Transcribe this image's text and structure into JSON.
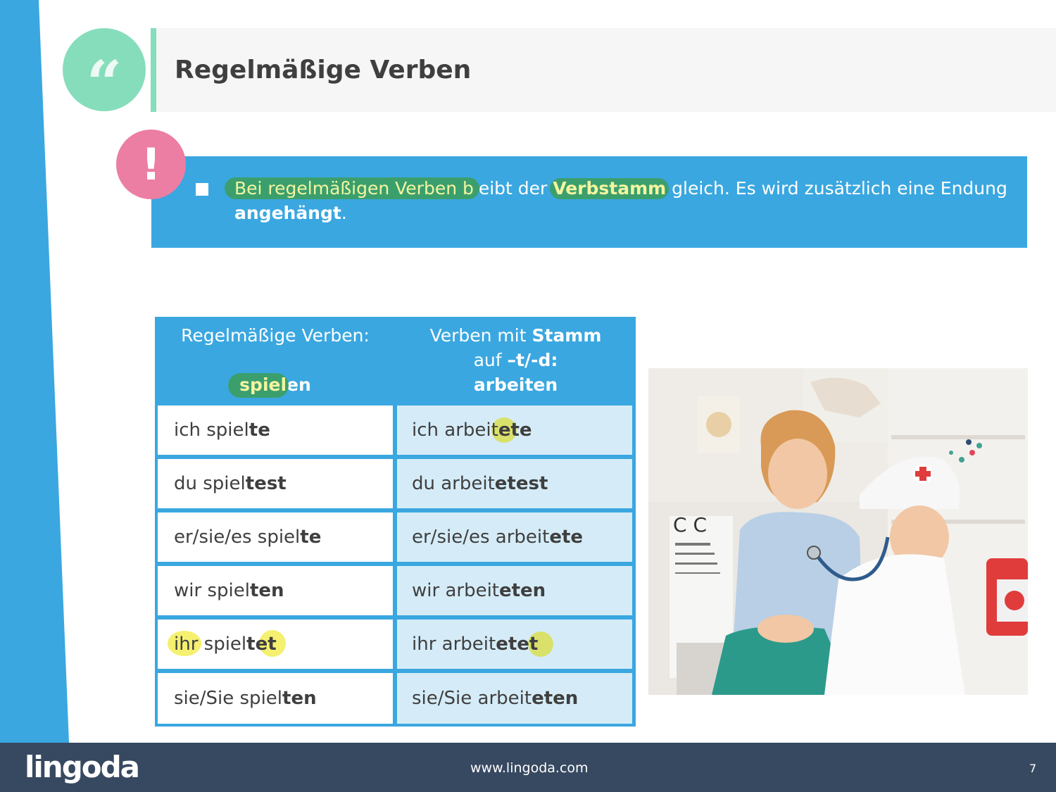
{
  "slide": {
    "title": "Regelmäßige Verben",
    "quote_glyph": "“",
    "alert_glyph": "!"
  },
  "info": {
    "part1": "Bei regelmäßigen Verben b",
    "part2": "leibt der ",
    "part3": "Verbstamm",
    "part4": " gleich. Es  wird zusätzlich eine Endung ",
    "part5": "angehängt",
    "part6": "."
  },
  "table": {
    "col1_header": "Regelmäßige Verben:",
    "col1_stem": "spiel",
    "col1_ending": "en",
    "col2_header_prefix": "Verben mit ",
    "col2_header_bold": "Stamm",
    "col2_header_line2_prefix": "auf ",
    "col2_header_line2_bold": "–t/-d:",
    "col2_header_verb": "arbeiten",
    "rows": [
      {
        "c1_stem": "ich spiel",
        "c1_end": "te",
        "c2_stem": "ich arbeit",
        "c2_end": "ete"
      },
      {
        "c1_stem": "du spiel",
        "c1_end": "test",
        "c2_stem": "du arbeit",
        "c2_end": "etest"
      },
      {
        "c1_stem": "er/sie/es spiel",
        "c1_end": "te",
        "c2_stem": "er/sie/es arbeit",
        "c2_end": "ete"
      },
      {
        "c1_stem": "wir spiel",
        "c1_end": "ten",
        "c2_stem": "wir arbeit",
        "c2_end": "eten"
      },
      {
        "c1_stem": "ihr spiel",
        "c1_end": "tet",
        "c2_stem": "ihr arbeit",
        "c2_end": "etet"
      },
      {
        "c1_stem": "sie/Sie spiel",
        "c1_end": "ten",
        "c2_stem": "sie/Sie arbeit",
        "c2_end": "eten"
      }
    ]
  },
  "footer": {
    "logo": "lingoda",
    "url": "www.lingoda.com",
    "page_number": "7"
  },
  "colors": {
    "accent_blue": "#3aa7e0",
    "mint": "#86ddbc",
    "pink": "#ec7ea3",
    "highlight_green": "#3b9f6d",
    "highlight_yellow": "#f4ee5f",
    "footer_navy": "#374961"
  }
}
